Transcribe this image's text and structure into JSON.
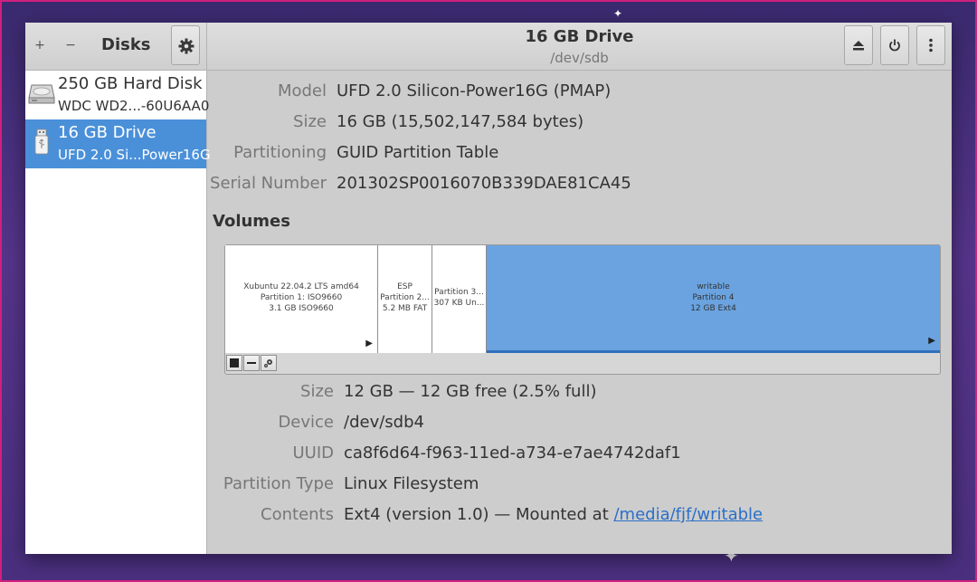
{
  "sidebar": {
    "title": "Disks",
    "add_glyph": "+",
    "remove_glyph": "−",
    "drives": [
      {
        "name": "250 GB Hard Disk",
        "model": "WDC WD2...-60U6AA0",
        "icon": "hard-disk-icon",
        "selected": false
      },
      {
        "name": "16 GB Drive",
        "model": "UFD 2.0 Si...Power16G",
        "icon": "usb-drive-icon",
        "selected": true
      }
    ]
  },
  "header": {
    "title": "16 GB Drive",
    "subtitle": "/dev/sdb",
    "buttons": [
      "eject-icon",
      "power-icon",
      "more-vertical-icon"
    ]
  },
  "drive_info": {
    "model_label": "Model",
    "model": "UFD 2.0 Silicon-Power16G (PMAP)",
    "size_label": "Size",
    "size": "16 GB (15,502,147,584 bytes)",
    "partitioning_label": "Partitioning",
    "partitioning": "GUID Partition Table",
    "serial_label": "Serial Number",
    "serial": "201302SP0016070B339DAE81CA45"
  },
  "volumes": {
    "heading": "Volumes",
    "partitions": [
      {
        "line1": "Xubuntu 22.04.2 LTS amd64",
        "line2": "Partition 1: ISO9660",
        "line3": "3.1 GB ISO9660",
        "selected": false
      },
      {
        "line1": "ESP",
        "line2": "Partition 2...",
        "line3": "5.2 MB FAT",
        "selected": false
      },
      {
        "line1": "Partition 3...",
        "line2": "307 KB Un...",
        "line3": "",
        "selected": false
      },
      {
        "line1": "writable",
        "line2": "Partition 4",
        "line3": "12 GB Ext4",
        "selected": true
      }
    ],
    "toolbar": [
      "stop-icon",
      "minus-icon",
      "gears-icon"
    ]
  },
  "volume_info": {
    "size_label": "Size",
    "size": "12 GB — 12 GB free (2.5% full)",
    "device_label": "Device",
    "device": "/dev/sdb4",
    "uuid_label": "UUID",
    "uuid": "ca8f6d64-f963-11ed-a734-e7ae4742daf1",
    "type_label": "Partition Type",
    "type": "Linux Filesystem",
    "contents_label": "Contents",
    "contents_prefix": "Ext4 (version 1.0) — Mounted at ",
    "mount_link": "/media/fjf/writable"
  },
  "colors": {
    "selection": "#4a90d9",
    "accent_border": "#d0207f",
    "link": "#2a6fc9"
  }
}
